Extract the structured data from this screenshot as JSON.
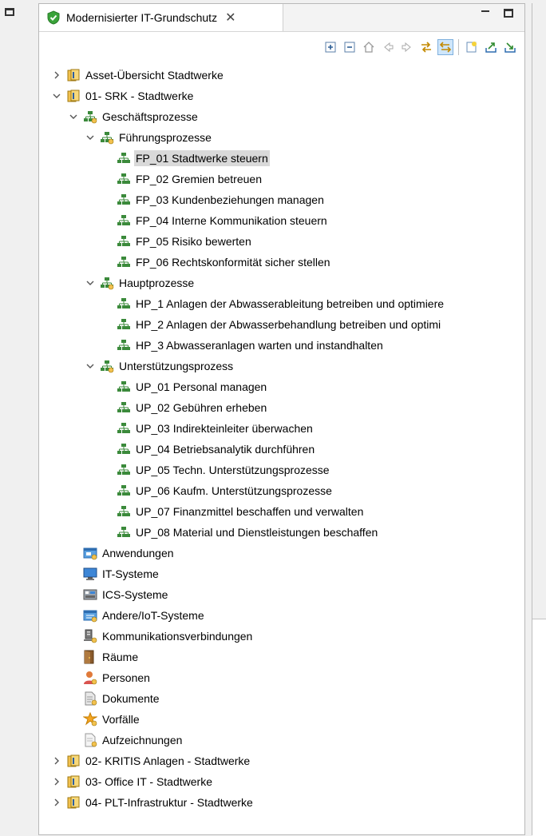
{
  "view": {
    "tab_title": "Modernisierter IT-Grundschutz",
    "close_glyph": "✕"
  },
  "toolbar": {
    "buttons": [
      "expand-all-icon",
      "collapse-all-icon",
      "home-icon",
      "back-icon",
      "forward-icon",
      "link-editor-icon",
      "sync-icon",
      "new-element-icon",
      "import-icon",
      "export-icon"
    ]
  },
  "tree": [
    {
      "label": "Asset-Übersicht Stadtwerke",
      "level": 0,
      "toggle": "collapsed",
      "icon": "scope"
    },
    {
      "label": "01- SRK - Stadtwerke",
      "level": 0,
      "toggle": "expanded",
      "icon": "scope"
    },
    {
      "label": "Geschäftsprozesse",
      "level": 1,
      "toggle": "expanded",
      "icon": "process-group"
    },
    {
      "label": "Führungsprozesse",
      "level": 2,
      "toggle": "expanded",
      "icon": "process-group"
    },
    {
      "label": "FP_01 Stadtwerke steuern",
      "level": 3,
      "toggle": "none",
      "icon": "process",
      "selected": true
    },
    {
      "label": "FP_02 Gremien betreuen",
      "level": 3,
      "toggle": "none",
      "icon": "process"
    },
    {
      "label": "FP_03 Kundenbeziehungen managen",
      "level": 3,
      "toggle": "none",
      "icon": "process"
    },
    {
      "label": "FP_04 Interne Kommunikation steuern",
      "level": 3,
      "toggle": "none",
      "icon": "process"
    },
    {
      "label": "FP_05 Risiko bewerten",
      "level": 3,
      "toggle": "none",
      "icon": "process"
    },
    {
      "label": "FP_06 Rechtskonformität sicher stellen",
      "level": 3,
      "toggle": "none",
      "icon": "process"
    },
    {
      "label": "Hauptprozesse",
      "level": 2,
      "toggle": "expanded",
      "icon": "process-group"
    },
    {
      "label": "HP_1 Anlagen der Abwasserableitung betreiben und optimiere",
      "level": 3,
      "toggle": "none",
      "icon": "process"
    },
    {
      "label": "HP_2 Anlagen der Abwasserbehandlung betreiben und optimi",
      "level": 3,
      "toggle": "none",
      "icon": "process"
    },
    {
      "label": "HP_3 Abwasseranlagen warten und instandhalten",
      "level": 3,
      "toggle": "none",
      "icon": "process"
    },
    {
      "label": "Unterstützungsprozess",
      "level": 2,
      "toggle": "expanded",
      "icon": "process-group"
    },
    {
      "label": "UP_01 Personal managen",
      "level": 3,
      "toggle": "none",
      "icon": "process"
    },
    {
      "label": "UP_02 Gebühren erheben",
      "level": 3,
      "toggle": "none",
      "icon": "process"
    },
    {
      "label": "UP_03 Indirekteinleiter überwachen",
      "level": 3,
      "toggle": "none",
      "icon": "process"
    },
    {
      "label": "UP_04 Betriebsanalytik durchführen",
      "level": 3,
      "toggle": "none",
      "icon": "process"
    },
    {
      "label": "UP_05 Techn. Unterstützungsprozesse",
      "level": 3,
      "toggle": "none",
      "icon": "process"
    },
    {
      "label": "UP_06 Kaufm. Unterstützungsprozesse",
      "level": 3,
      "toggle": "none",
      "icon": "process"
    },
    {
      "label": "UP_07 Finanzmittel beschaffen und verwalten",
      "level": 3,
      "toggle": "none",
      "icon": "process"
    },
    {
      "label": "UP_08 Material und Dienstleistungen beschaffen",
      "level": 3,
      "toggle": "none",
      "icon": "process"
    },
    {
      "label": "Anwendungen",
      "level": 1,
      "toggle": "none",
      "icon": "applications"
    },
    {
      "label": "IT-Systeme",
      "level": 1,
      "toggle": "none",
      "icon": "it-systems"
    },
    {
      "label": "ICS-Systeme",
      "level": 1,
      "toggle": "none",
      "icon": "ics-systems"
    },
    {
      "label": "Andere/IoT-Systeme",
      "level": 1,
      "toggle": "none",
      "icon": "iot-systems"
    },
    {
      "label": "Kommunikationsverbindungen",
      "level": 1,
      "toggle": "none",
      "icon": "network"
    },
    {
      "label": "Räume",
      "level": 1,
      "toggle": "none",
      "icon": "rooms"
    },
    {
      "label": "Personen",
      "level": 1,
      "toggle": "none",
      "icon": "persons"
    },
    {
      "label": "Dokumente",
      "level": 1,
      "toggle": "none",
      "icon": "documents"
    },
    {
      "label": "Vorfälle",
      "level": 1,
      "toggle": "none",
      "icon": "incidents"
    },
    {
      "label": "Aufzeichnungen",
      "level": 1,
      "toggle": "none",
      "icon": "records"
    },
    {
      "label": "02- KRITIS Anlagen - Stadtwerke",
      "level": 0,
      "toggle": "collapsed",
      "icon": "scope"
    },
    {
      "label": "03- Office IT - Stadtwerke",
      "level": 0,
      "toggle": "collapsed",
      "icon": "scope"
    },
    {
      "label": "04- PLT-Infrastruktur - Stadtwerke",
      "level": 0,
      "toggle": "collapsed",
      "icon": "scope"
    }
  ]
}
